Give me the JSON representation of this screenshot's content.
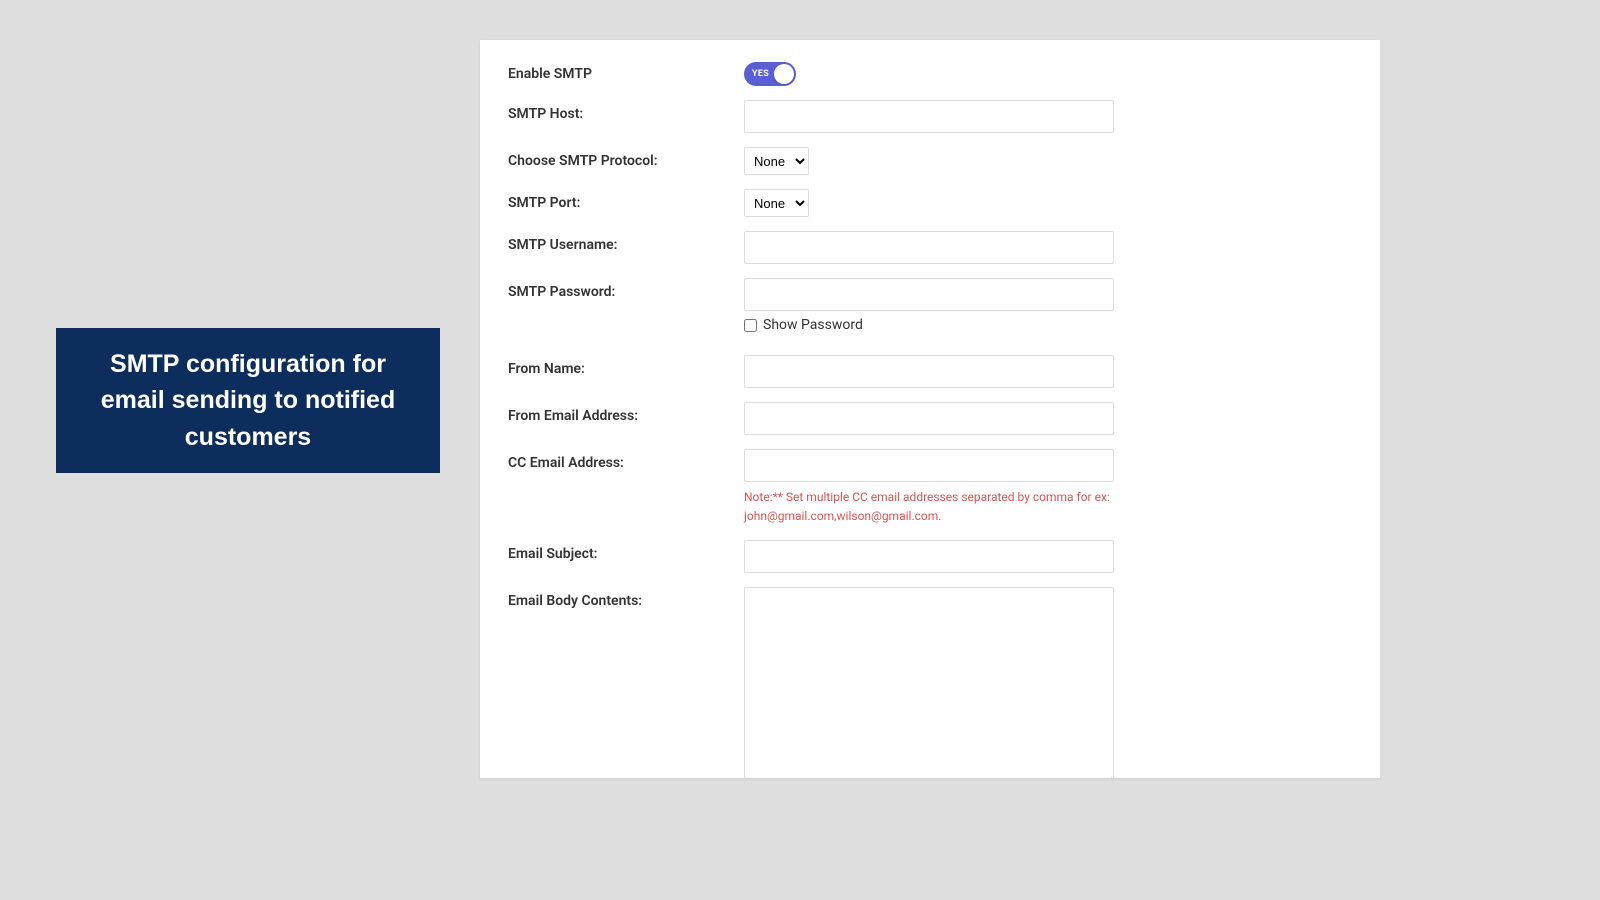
{
  "callout": {
    "text": "SMTP configuration for email sending to notified customers"
  },
  "form": {
    "enable_smtp": {
      "label": "Enable SMTP",
      "toggle_text": "YES",
      "value": true
    },
    "smtp_host": {
      "label": "SMTP Host:",
      "value": ""
    },
    "smtp_protocol": {
      "label": "Choose SMTP Protocol:",
      "selected": "None",
      "options": [
        "None"
      ]
    },
    "smtp_port": {
      "label": "SMTP Port:",
      "selected": "None",
      "options": [
        "None"
      ]
    },
    "smtp_username": {
      "label": "SMTP Username:",
      "value": ""
    },
    "smtp_password": {
      "label": "SMTP Password:",
      "value": "",
      "show_password_label": "Show Password",
      "show_password_checked": false
    },
    "from_name": {
      "label": "From Name:",
      "value": ""
    },
    "from_email": {
      "label": "From Email Address:",
      "value": ""
    },
    "cc_email": {
      "label": "CC Email Address:",
      "value": "",
      "note": "Note:** Set multiple CC email addresses separated by comma for ex: john@gmail.com,wilson@gmail.com."
    },
    "email_subject": {
      "label": "Email Subject:",
      "value": ""
    },
    "email_body": {
      "label": "Email Body Contents:",
      "value": ""
    }
  }
}
